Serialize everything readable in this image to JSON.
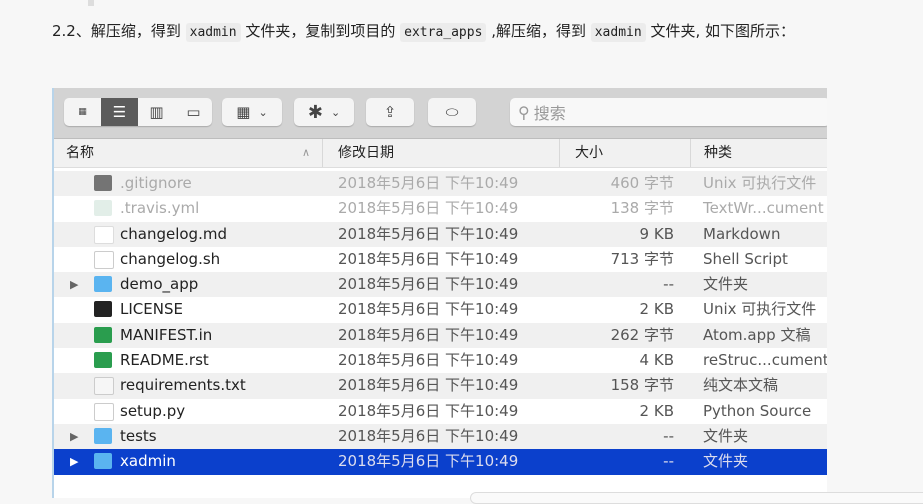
{
  "paragraph": {
    "p1": "2.2、解压缩，得到 ",
    "code1": "xadmin",
    "p2": " 文件夹，复制到项目的 ",
    "code2": "extra_apps",
    "p3": " ,解压缩，得到 ",
    "code3": "xadmin",
    "p4": " 文件夹, 如下图所示："
  },
  "toolbar": {
    "search_placeholder": "搜索"
  },
  "columns": {
    "name": "名称",
    "date": "修改日期",
    "size": "大小",
    "kind": "种类"
  },
  "files": [
    {
      "name": ".gitignore",
      "date": "2018年5月6日 下午10:49",
      "size": "460 字节",
      "kind": "Unix 可执行文件",
      "icon": "terminal-icon",
      "dim": true
    },
    {
      "name": ".travis.yml",
      "date": "2018年5月6日 下午10:49",
      "size": "138 字节",
      "kind": "TextWr...cument",
      "icon": "yml-file-icon",
      "dim": true
    },
    {
      "name": "changelog.md",
      "date": "2018年5月6日 下午10:49",
      "size": "9 KB",
      "kind": "Markdown",
      "icon": "markdown-icon"
    },
    {
      "name": "changelog.sh",
      "date": "2018年5月6日 下午10:49",
      "size": "713 字节",
      "kind": "Shell Script",
      "icon": "document-icon"
    },
    {
      "name": "demo_app",
      "date": "2018年5月6日 下午10:49",
      "size": "--",
      "kind": "文件夹",
      "icon": "folder-icon",
      "folder": true
    },
    {
      "name": "LICENSE",
      "date": "2018年5月6日 下午10:49",
      "size": "2 KB",
      "kind": "Unix 可执行文件",
      "icon": "terminal-icon"
    },
    {
      "name": "MANIFEST.in",
      "date": "2018年5月6日 下午10:49",
      "size": "262 字节",
      "kind": "Atom.app 文稿",
      "icon": "atom-icon"
    },
    {
      "name": "README.rst",
      "date": "2018年5月6日 下午10:49",
      "size": "4 KB",
      "kind": "reStruc...cument",
      "icon": "atom-icon"
    },
    {
      "name": "requirements.txt",
      "date": "2018年5月6日 下午10:49",
      "size": "158 字节",
      "kind": "纯文本文稿",
      "icon": "text-file-icon"
    },
    {
      "name": "setup.py",
      "date": "2018年5月6日 下午10:49",
      "size": "2 KB",
      "kind": "Python Source",
      "icon": "python-file-icon"
    },
    {
      "name": "tests",
      "date": "2018年5月6日 下午10:49",
      "size": "--",
      "kind": "文件夹",
      "icon": "folder-icon",
      "folder": true
    },
    {
      "name": "xadmin",
      "date": "2018年5月6日 下午10:49",
      "size": "--",
      "kind": "文件夹",
      "icon": "folder-icon",
      "folder": true,
      "selected": true
    }
  ],
  "colors": {
    "selection": "#0b40cc",
    "folder": "#5ab4f0"
  }
}
